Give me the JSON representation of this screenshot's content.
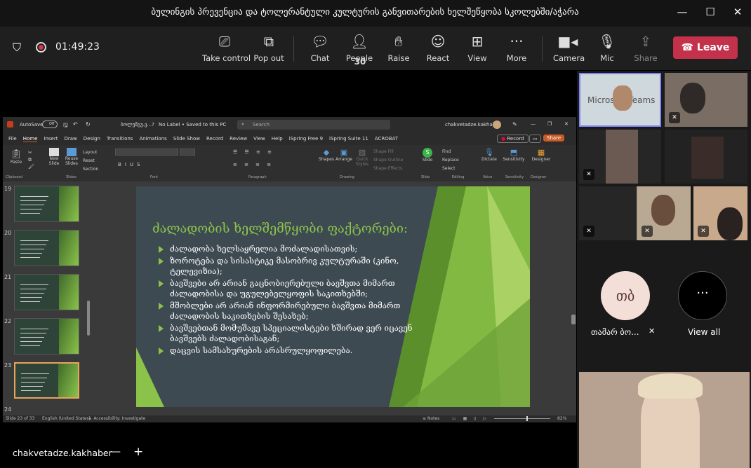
{
  "window": {
    "title": "ბულინგის პრევენცია და ტოლერანტული კულტურის განვითარების ხელშეწყობა სკოლებში/აჭარა"
  },
  "meeting": {
    "timer": "01:49:23",
    "people_count": "30",
    "buttons": {
      "take_control": "Take control",
      "pop_out": "Pop out",
      "chat": "Chat",
      "people": "People",
      "raise": "Raise",
      "react": "React",
      "view": "View",
      "more": "More",
      "camera": "Camera",
      "mic": "Mic",
      "share": "Share",
      "leave": "Leave"
    }
  },
  "ppt": {
    "autosave": "AutoSave",
    "autosave_state": "Off",
    "filename": "ბოლუმგუ.ვ...?",
    "label": "No Label • Saved to this PC",
    "search_placeholder": "Search",
    "user": "chakvetadze.kakhaber",
    "menu": [
      "File",
      "Home",
      "Insert",
      "Draw",
      "Design",
      "Transitions",
      "Animations",
      "Slide Show",
      "Record",
      "Review",
      "View",
      "Help",
      "iSpring Free 9",
      "iSpring Suite 11",
      "ACROBAT"
    ],
    "record_btn": "Record",
    "share_btn": "Share",
    "ribbon_groups": [
      "Clipboard",
      "Slides",
      "Font",
      "Paragraph",
      "Drawing",
      "Slido",
      "Editing",
      "Voice",
      "Sensitivity",
      "Designer"
    ],
    "ribbon_items": {
      "paste": "Paste",
      "new_slide": "New Slide",
      "reuse_slides": "Reuse Slides",
      "layout": "Layout",
      "reset": "Reset",
      "section": "Section",
      "shapes": "Shapes",
      "arrange": "Arrange",
      "quick_styles": "Quick Styles",
      "shape_fill": "Shape Fill",
      "shape_outline": "Shape Outline",
      "shape_effects": "Shape Effects",
      "slido": "Slido",
      "find": "Find",
      "replace": "Replace",
      "select": "Select",
      "dictate": "Dictate",
      "sensitivity": "Sensitivity",
      "designer": "Designer"
    },
    "thumb_numbers": [
      "19",
      "20",
      "21",
      "22",
      "23",
      "24"
    ],
    "status": {
      "slide_of": "Slide 23 of 33",
      "language": "English (United States)",
      "accessibility": "Accessibility: Investigate",
      "notes": "Notes",
      "zoom": "82%"
    },
    "slide": {
      "title": "ძალადობის ხელშემწყობი ფაქტორები:",
      "bullets": [
        "ძალადობა ხელსაყრელია მოძალადისათვის;",
        "ზოროტება და სისასტიკე მასობრივ კულტურაში (კინო, ტელევიზია);",
        "ბავშვები არ არიან გაცნობიერებული ბავშვთა მიმართ ძალადობისა და უგულებელყოფის საკითხებში;",
        "მშობლები არ არიან ინფორმირებული ბავშვთა მიმართ ძალადობის საკითხების შესახებ;",
        "ბავშვებთან მომუშავე სპეციალისტები ხშირად ვერ იცავენ ბავშვებს ძალადობისაგან;",
        "დაცვის სამსახურების არასრულყოფილება."
      ]
    }
  },
  "participants": {
    "tile1_label": "Microsoft Teams",
    "avatar_initials": "თბ",
    "avatar_name": "თამარ ბო...",
    "view_all": "View all"
  },
  "bottom": {
    "presenter": "chakvetadze.kakhaber",
    "minus": "—",
    "plus": "+"
  }
}
